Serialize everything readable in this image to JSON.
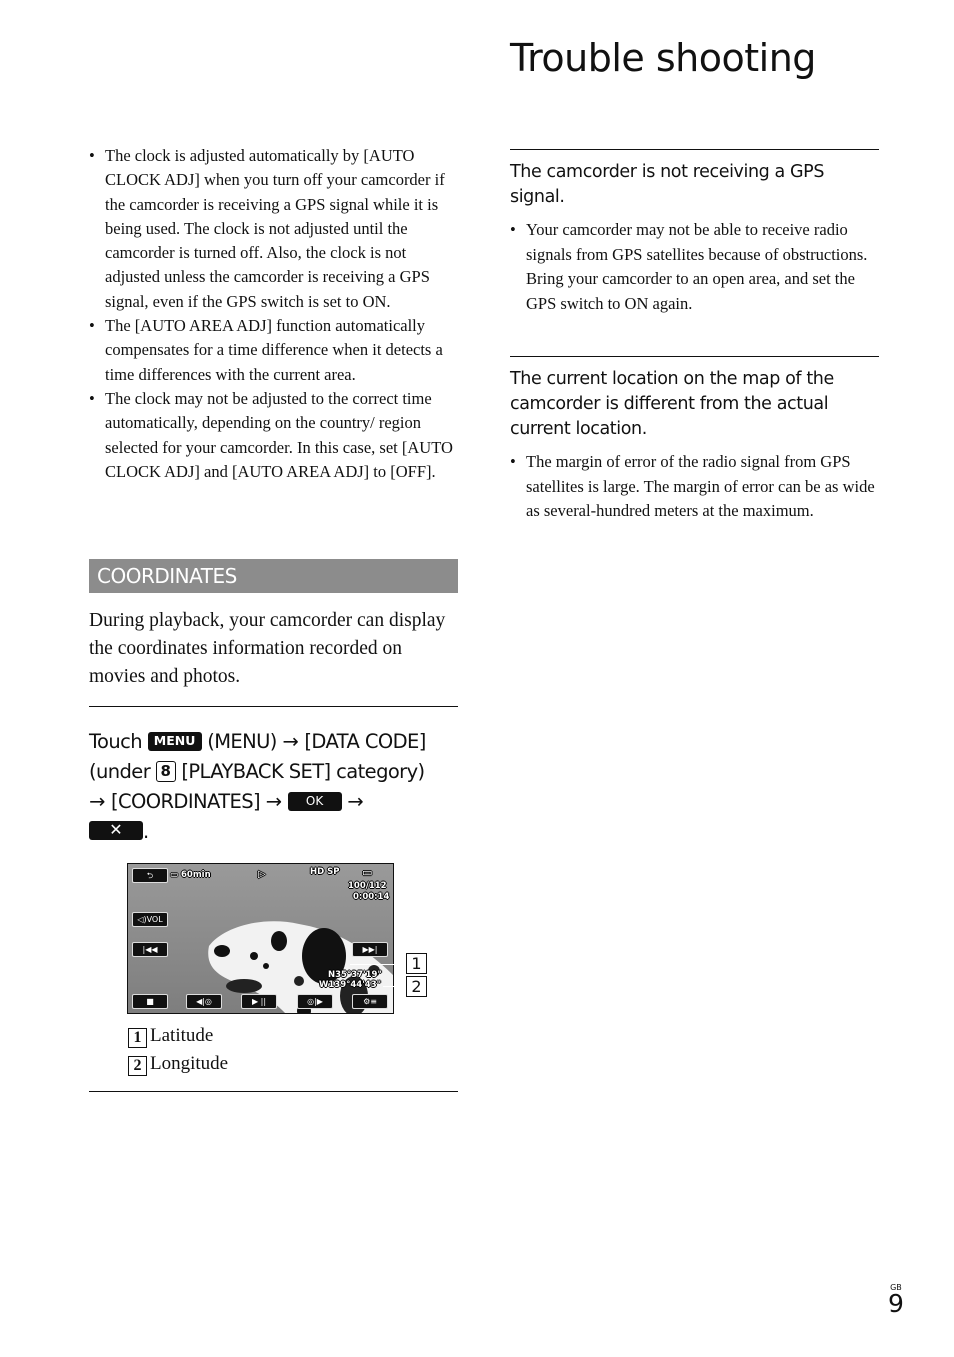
{
  "page": {
    "title": "Trouble shooting",
    "page_number": "9",
    "region_code": "GB"
  },
  "left": {
    "bullets": [
      "The clock is adjusted automatically by [AUTO CLOCK ADJ] when you turn off your camcorder if the camcorder is receiving a GPS signal while it is being used. The clock is not adjusted until the camcorder is turned off. Also, the clock is not adjusted unless the camcorder is receiving a GPS signal, even if the GPS switch is set to ON.",
      "The [AUTO AREA ADJ] function automatically compensates for a time difference when it detects a time differences with the current area.",
      "The clock may not be adjusted to the correct time automatically, depending on the country/ region selected for your camcorder. In this case, set [AUTO CLOCK ADJ] and [AUTO AREA ADJ] to [OFF]."
    ],
    "section_title": "COORDINATES",
    "intro": "During playback, your camcorder can display the coordinates information recorded on movies and photos.",
    "instruction": {
      "touch": "Touch",
      "menu_key": "MENU",
      "menu_label": "(MENU)",
      "arrow": "→",
      "data_code": "[DATA CODE]",
      "under": "(under",
      "category_num": "8",
      "category": "[PLAYBACK SET] category)",
      "coordinates": "[COORDINATES]",
      "ok_key": "OK",
      "close_key": "✕",
      "period": "."
    },
    "screen": {
      "battery": "60min",
      "quality": [
        "HD",
        "SP"
      ],
      "counter": "100/112",
      "time": "0:00:14",
      "vol_label": "VOL",
      "latitude": "N35°37'19\"",
      "longitude": "W139°44'43\"",
      "callouts": [
        "1",
        "2"
      ]
    },
    "legend": [
      {
        "num": "1",
        "label": "Latitude"
      },
      {
        "num": "2",
        "label": "Longitude"
      }
    ]
  },
  "right": {
    "sections": [
      {
        "heading": "The camcorder is not receiving a GPS signal.",
        "bullets": [
          "Your camcorder may not be able to receive radio signals from GPS satellites because of obstructions. Bring your camcorder to an open area, and set the GPS switch to ON again."
        ]
      },
      {
        "heading": "The current location on the map of the camcorder is different from the actual current location.",
        "bullets": [
          "The margin of error of the radio signal from GPS satellites is large. The margin of error can be as wide as several-hundred meters at the maximum."
        ]
      }
    ]
  }
}
